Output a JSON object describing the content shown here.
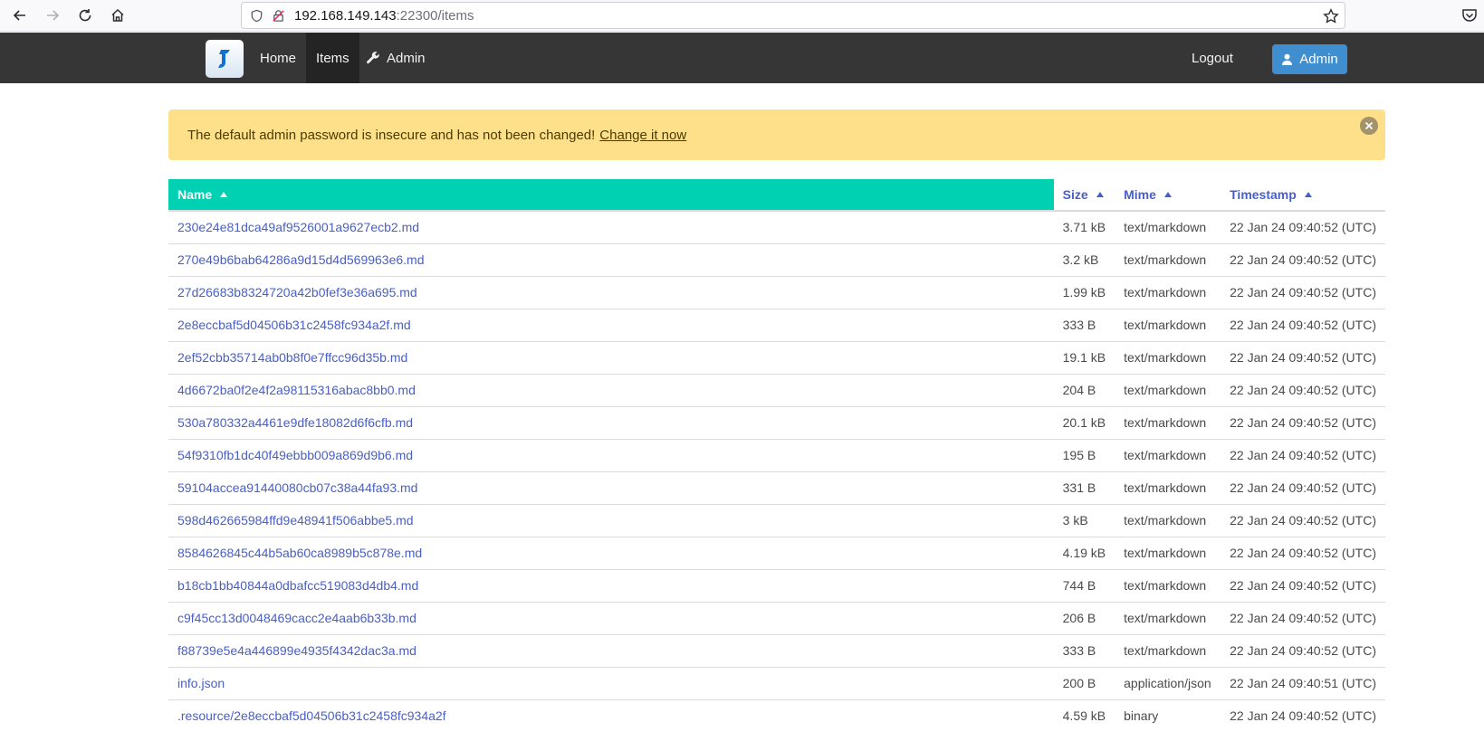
{
  "browser": {
    "url_host": "192.168.149.143",
    "url_rest": ":22300/items"
  },
  "navbar": {
    "home": "Home",
    "items": "Items",
    "admin_menu": "Admin",
    "logout": "Logout",
    "admin_button": "Admin"
  },
  "notice": {
    "message": "The default admin password is insecure and has not been changed!",
    "link": "Change it now"
  },
  "table": {
    "headers": {
      "name": "Name",
      "size": "Size",
      "mime": "Mime",
      "timestamp": "Timestamp"
    },
    "rows": [
      {
        "name": "230e24e81dca49af9526001a9627ecb2.md",
        "size": "3.71 kB",
        "mime": "text/markdown",
        "timestamp": "22 Jan 24 09:40:52 (UTC)"
      },
      {
        "name": "270e49b6bab64286a9d15d4d569963e6.md",
        "size": "3.2 kB",
        "mime": "text/markdown",
        "timestamp": "22 Jan 24 09:40:52 (UTC)"
      },
      {
        "name": "27d26683b8324720a42b0fef3e36a695.md",
        "size": "1.99 kB",
        "mime": "text/markdown",
        "timestamp": "22 Jan 24 09:40:52 (UTC)"
      },
      {
        "name": "2e8eccbaf5d04506b31c2458fc934a2f.md",
        "size": "333 B",
        "mime": "text/markdown",
        "timestamp": "22 Jan 24 09:40:52 (UTC)"
      },
      {
        "name": "2ef52cbb35714ab0b8f0e7ffcc96d35b.md",
        "size": "19.1 kB",
        "mime": "text/markdown",
        "timestamp": "22 Jan 24 09:40:52 (UTC)"
      },
      {
        "name": "4d6672ba0f2e4f2a98115316abac8bb0.md",
        "size": "204 B",
        "mime": "text/markdown",
        "timestamp": "22 Jan 24 09:40:52 (UTC)"
      },
      {
        "name": "530a780332a4461e9dfe18082d6f6cfb.md",
        "size": "20.1 kB",
        "mime": "text/markdown",
        "timestamp": "22 Jan 24 09:40:52 (UTC)"
      },
      {
        "name": "54f9310fb1dc40f49ebbb009a869d9b6.md",
        "size": "195 B",
        "mime": "text/markdown",
        "timestamp": "22 Jan 24 09:40:52 (UTC)"
      },
      {
        "name": "59104accea91440080cb07c38a44fa93.md",
        "size": "331 B",
        "mime": "text/markdown",
        "timestamp": "22 Jan 24 09:40:52 (UTC)"
      },
      {
        "name": "598d462665984ffd9e48941f506abbe5.md",
        "size": "3 kB",
        "mime": "text/markdown",
        "timestamp": "22 Jan 24 09:40:52 (UTC)"
      },
      {
        "name": "8584626845c44b5ab60ca8989b5c878e.md",
        "size": "4.19 kB",
        "mime": "text/markdown",
        "timestamp": "22 Jan 24 09:40:52 (UTC)"
      },
      {
        "name": "b18cb1bb40844a0dbafcc519083d4db4.md",
        "size": "744 B",
        "mime": "text/markdown",
        "timestamp": "22 Jan 24 09:40:52 (UTC)"
      },
      {
        "name": "c9f45cc13d0048469cacc2e4aab6b33b.md",
        "size": "206 B",
        "mime": "text/markdown",
        "timestamp": "22 Jan 24 09:40:52 (UTC)"
      },
      {
        "name": "f88739e5e4a446899e4935f4342dac3a.md",
        "size": "333 B",
        "mime": "text/markdown",
        "timestamp": "22 Jan 24 09:40:52 (UTC)"
      },
      {
        "name": "info.json",
        "size": "200 B",
        "mime": "application/json",
        "timestamp": "22 Jan 24 09:40:51 (UTC)"
      },
      {
        "name": ".resource/2e8eccbaf5d04506b31c2458fc934a2f",
        "size": "4.59 kB",
        "mime": "binary",
        "timestamp": "22 Jan 24 09:40:52 (UTC)"
      }
    ]
  },
  "colors": {
    "navbar": "#363636",
    "sorted_header": "#00d1b2",
    "link": "#485fc7",
    "notice": "#ffe08a",
    "admin_button": "#3e8ed0"
  }
}
